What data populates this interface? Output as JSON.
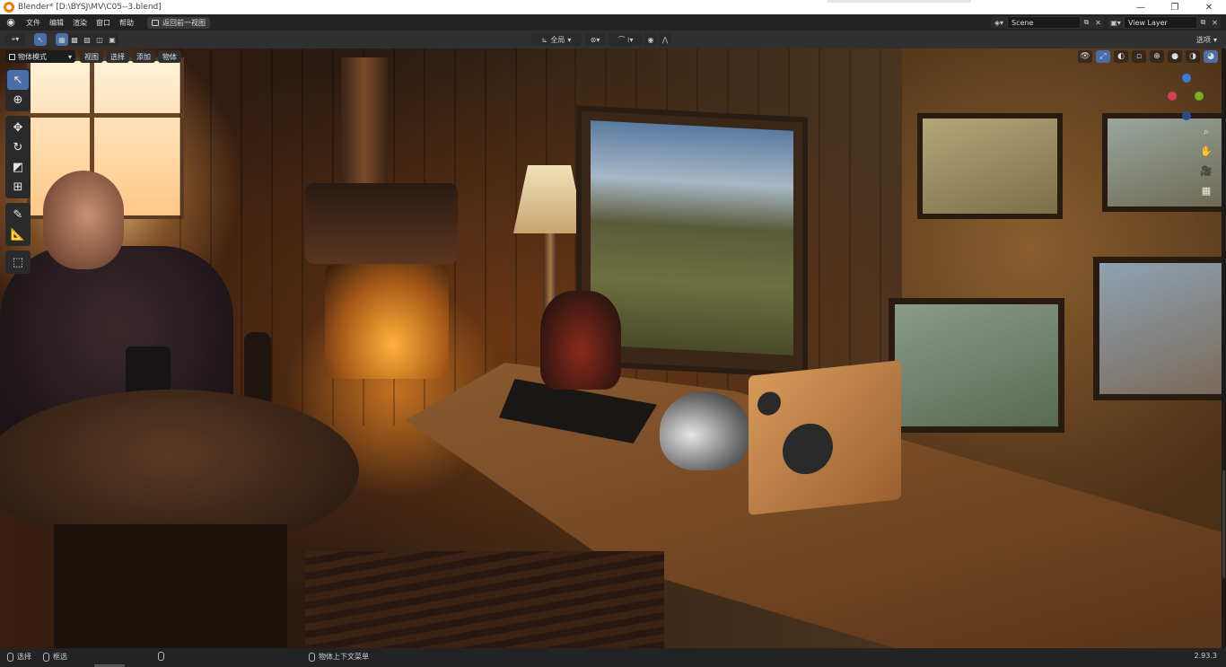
{
  "window": {
    "title": "Blender* [D:\\BYSJ\\MV\\C05--3.blend]",
    "controls": {
      "minimize": "—",
      "restore": "❐",
      "close": "✕"
    }
  },
  "menubar": {
    "items": [
      "文件",
      "编辑",
      "渲染",
      "窗口",
      "帮助"
    ],
    "back_button": "返回前一视图",
    "scene": {
      "label": "Scene"
    },
    "view_layer": {
      "label": "View Layer"
    }
  },
  "header": {
    "orientation": "全局",
    "options": "选项"
  },
  "viewport": {
    "mode": "物体模式",
    "menus": [
      "视图",
      "选择",
      "添加",
      "物体"
    ]
  },
  "status": {
    "select": "选择",
    "box_select": "框选",
    "context_menu": "物体上下文菜单",
    "version": "2.93.3"
  },
  "icons": {
    "blender": "blender-logo-icon",
    "cursor": "select-cursor-icon",
    "move": "move-icon",
    "rotate": "rotate-icon",
    "scale": "scale-icon",
    "transform": "transform-icon",
    "annotate": "annotate-icon",
    "measure": "measure-icon",
    "add_cube": "add-cube-icon",
    "zoom": "zoom-icon",
    "hand": "pan-hand-icon",
    "camera": "camera-icon",
    "grid": "ortho-grid-icon"
  },
  "colors": {
    "accent": "#4a6fa8",
    "ui_bg": "#303030",
    "blender_orange": "#e87d0d"
  }
}
